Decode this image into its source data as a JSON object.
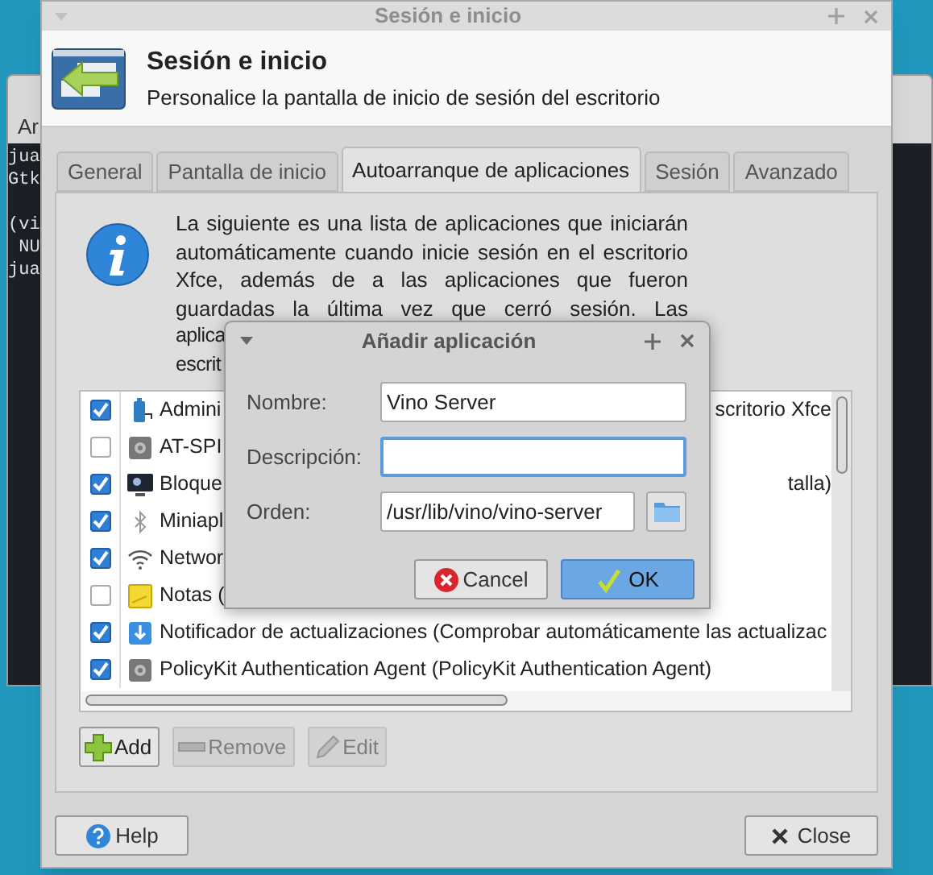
{
  "terminal": {
    "menu": "Ar",
    "blocks": [
      [
        "jua",
        "Gtk"
      ],
      [
        "(vi",
        " NU",
        "jua"
      ]
    ]
  },
  "window": {
    "title": "Sesión e inicio",
    "heading": "Sesión e inicio",
    "subtitle": "Personalice la pantalla de inicio de sesión del escritorio"
  },
  "tabs": [
    {
      "label": "General",
      "selected": false
    },
    {
      "label": "Pantalla de inicio",
      "selected": false
    },
    {
      "label": "Autoarranque de aplicaciones",
      "selected": true
    },
    {
      "label": "Sesión",
      "selected": false
    },
    {
      "label": "Avanzado",
      "selected": false
    }
  ],
  "info": {
    "text": "La siguiente es una lista de aplicaciones que iniciarán automáticamente cuando inicie sesión en el escritorio Xfce, además de a las aplicaciones que fueron guardadas la última vez que cerró sesión. Las",
    "fragments": [
      "aplica",
      "escrit"
    ]
  },
  "apps": [
    {
      "name": "Admini",
      "tail": "scritorio Xfce",
      "checked": true
    },
    {
      "name": "AT-SPI",
      "checked": false
    },
    {
      "name": "Bloque",
      "tail": "talla)",
      "checked": true
    },
    {
      "name": "Miniapl",
      "checked": true
    },
    {
      "name": "Networ",
      "checked": true
    },
    {
      "name": "Notas (",
      "checked": false
    },
    {
      "name": "Notificador de actualizaciones (Comprobar automáticamente las actualizac",
      "checked": true
    },
    {
      "name": "PolicyKit Authentication Agent (PolicyKit Authentication Agent)",
      "checked": true
    }
  ],
  "list_buttons": [
    {
      "label": "Add",
      "disabled": false
    },
    {
      "label": "Remove",
      "disabled": true
    },
    {
      "label": "Edit",
      "disabled": true
    }
  ],
  "footer": {
    "help": "Help",
    "close": "Close"
  },
  "dialog": {
    "title": "Añadir aplicación",
    "fields": [
      {
        "label": "Nombre:",
        "value": "Vino Server",
        "focused": false
      },
      {
        "label": "Descripción:",
        "focused": true
      },
      {
        "label": "Orden:",
        "value": "/usr/lib/vino/vino-server",
        "focused": false,
        "browse": true
      }
    ],
    "cancel": "Cancel",
    "ok": "OK"
  }
}
